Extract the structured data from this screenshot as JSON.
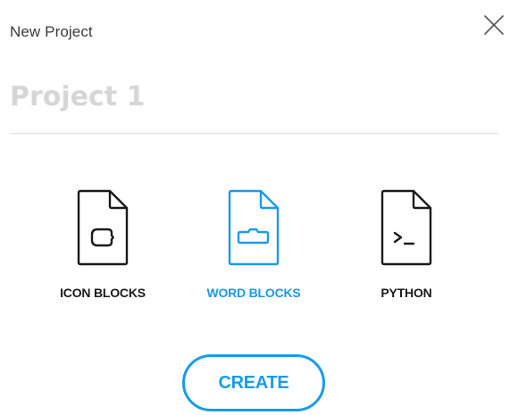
{
  "dialog": {
    "title": "New Project",
    "close_icon": "close-icon"
  },
  "project_name": {
    "value": "",
    "placeholder": "Project 1"
  },
  "project_types": [
    {
      "label": "ICON BLOCKS",
      "icon": "icon-blocks-file-icon",
      "selected": false,
      "color": "#1a1a1a"
    },
    {
      "label": "WORD BLOCKS",
      "icon": "word-blocks-file-icon",
      "selected": true,
      "color": "#1a9be8"
    },
    {
      "label": "PYTHON",
      "icon": "python-file-icon",
      "selected": false,
      "color": "#1a1a1a"
    }
  ],
  "create_button": {
    "label": "CREATE"
  },
  "colors": {
    "accent": "#1a9be8",
    "text_dark": "#1a1a1a",
    "placeholder": "#d6d6d6",
    "divider": "#e2e2e2"
  }
}
